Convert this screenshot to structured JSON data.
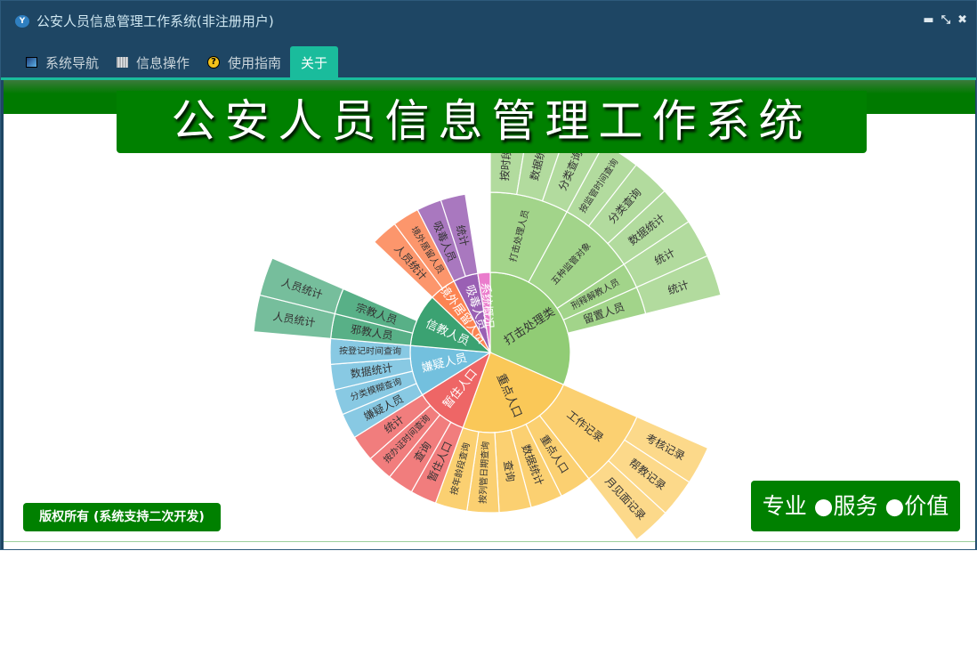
{
  "window": {
    "title": "公安人员信息管理工作系统(非注册用户)",
    "logo_text": "Y",
    "controls": [
      "minimize",
      "restore",
      "close"
    ]
  },
  "tabs": [
    {
      "label": "系统导航",
      "icon": "monitor-icon"
    },
    {
      "label": "信息操作",
      "icon": "grid-icon"
    },
    {
      "label": "使用指南",
      "icon": "help-icon"
    },
    {
      "label": "关于",
      "icon": "",
      "active": true
    }
  ],
  "banner": {
    "title": "公安人员信息管理工作系统"
  },
  "footer": {
    "copyright": "版权所有 (系统支持二次开发)",
    "slogan": "专业 ●服务 ●价值"
  },
  "chart_data": {
    "type": "sunburst",
    "nodes": [
      {
        "name": "打击处理类",
        "value": 113.7,
        "color": "#91cc75",
        "children": [
          {
            "name": "打击处理人员",
            "value": 28.6,
            "children": [
              {
                "name": "按时段查询",
                "value": 9.5
              },
              {
                "name": "数据统计",
                "value": 9.5
              },
              {
                "name": "分类查询",
                "value": 9.6
              }
            ]
          },
          {
            "name": "五种监管对象",
            "value": 28,
            "children": [
              {
                "name": "按监管时间查询",
                "value": 9.3
              },
              {
                "name": "分类查询",
                "value": 9.3
              },
              {
                "name": "数据统计",
                "value": 9.4
              }
            ]
          },
          {
            "name": "刑释解教人员",
            "value": 9.4,
            "children": [
              {
                "name": "统计",
                "value": 9.4
              }
            ]
          },
          {
            "name": "留置人员",
            "value": 10,
            "children": [
              {
                "name": "统计",
                "value": 10
              }
            ]
          }
        ]
      },
      {
        "name": "重点人口",
        "value": 86.3,
        "color": "#fac858",
        "children": [
          {
            "name": "工作记录",
            "value": 28.3,
            "children": [
              {
                "name": "考核记录",
                "value": 9.4
              },
              {
                "name": "帮教记录",
                "value": 9.4
              },
              {
                "name": "月见面记录",
                "value": 9.5
              }
            ]
          },
          {
            "name": "重点人口",
            "value": 11.6
          },
          {
            "name": "数据统计",
            "value": 11.6
          },
          {
            "name": "查询",
            "value": 11.6
          },
          {
            "name": "按列管日期查询",
            "value": 11.6
          },
          {
            "name": "按年龄段查询",
            "value": 11.6
          }
        ]
      },
      {
        "name": "暂住人口",
        "value": 38,
        "color": "#ee6666",
        "children": [
          {
            "name": "暂住人口",
            "value": 9.5
          },
          {
            "name": "查询",
            "value": 9.5
          },
          {
            "name": "按办证时间查询",
            "value": 9.5
          },
          {
            "name": "统计",
            "value": 9.5
          }
        ]
      },
      {
        "name": "嫌疑人员",
        "value": 37,
        "color": "#73c0de",
        "children": [
          {
            "name": "嫌疑人员",
            "value": 9.25
          },
          {
            "name": "分类模糊查询",
            "value": 9.25
          },
          {
            "name": "数据统计",
            "value": 9.25
          },
          {
            "name": "按登记时间查询",
            "value": 9.25
          }
        ]
      },
      {
        "name": "信教人员",
        "value": 38.6,
        "color": "#3ba272",
        "children": [
          {
            "name": "邪教人员",
            "value": 9,
            "children": [
              {
                "name": "人员统计",
                "value": 9
              }
            ]
          },
          {
            "name": "宗教人员",
            "value": 9.4,
            "children": [
              {
                "name": "人员统计",
                "value": 9.4
              }
            ]
          }
        ]
      },
      {
        "name": "境外居留人员",
        "value": 19.4,
        "color": "#fc8452",
        "children": [
          {
            "name": "人员统计",
            "value": 9.7
          },
          {
            "name": "境外居留人员",
            "value": 9.7
          }
        ]
      },
      {
        "name": "吸毒人员",
        "value": 18,
        "color": "#9a60b4",
        "children": [
          {
            "name": "吸毒人员",
            "value": 9
          },
          {
            "name": "统计",
            "value": 9
          }
        ]
      },
      {
        "name": "系统概况",
        "value": 9,
        "color": "#ea7ccc"
      }
    ]
  }
}
